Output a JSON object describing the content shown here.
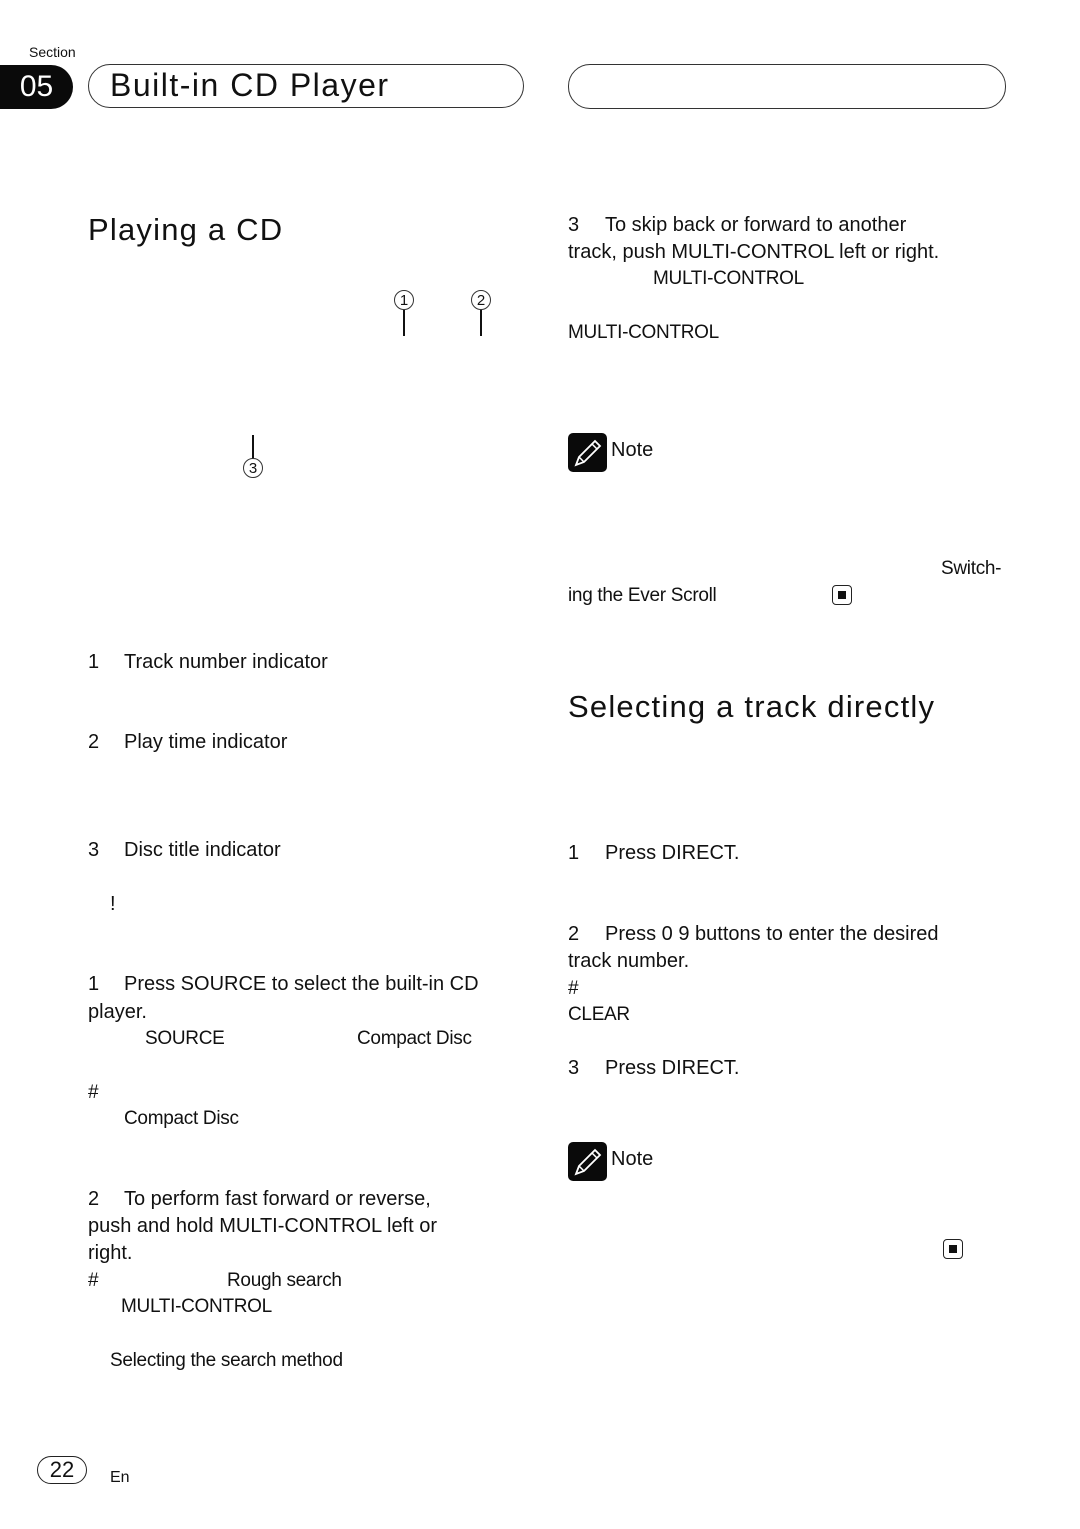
{
  "header": {
    "section_label": "Section",
    "section_number": "05",
    "chapter_title": "Built-in CD Player"
  },
  "left": {
    "heading": "Playing a CD",
    "callouts": [
      "1",
      "2",
      "3"
    ],
    "legend": [
      {
        "num": "1",
        "label": "Track number indicator"
      },
      {
        "num": "2",
        "label": "Play time indicator"
      },
      {
        "num": "3",
        "label": "Disc title indicator"
      }
    ],
    "warning_mark": "!",
    "step1": {
      "num": "1",
      "line1": "Press SOURCE to select the built-in CD",
      "line2": "player.",
      "frag_source": "SOURCE",
      "frag_compact": "Compact Disc",
      "hash": "#",
      "frag_compact2": "Compact Disc"
    },
    "step2": {
      "num": "2",
      "line1": "To perform fast forward or reverse,",
      "line2": "push and hold MULTI-CONTROL left or",
      "line3": "right.",
      "hash": "#",
      "frag_rough": "Rough search",
      "frag_multi": "MULTI-CONTROL",
      "frag_link": "Selecting the search method"
    }
  },
  "right": {
    "step3": {
      "num": "3",
      "line1": "To skip back or forward to another",
      "line2": "track, push MULTI-CONTROL left or right.",
      "frag_multi1": "MULTI-CONTROL",
      "frag_multi2": "MULTI-CONTROL"
    },
    "note1": {
      "label": "Note",
      "frag_switch": "Switch-",
      "frag_ever": "ing the Ever Scroll"
    },
    "heading2": "Selecting a track directly",
    "direct_steps": {
      "s1_num": "1",
      "s1_text": "Press DIRECT.",
      "s2_num": "2",
      "s2_line1": "Press 0  9 buttons to enter the desired",
      "s2_line2": "track number.",
      "hash": "#",
      "frag_clear": "CLEAR",
      "s3_num": "3",
      "s3_text": "Press DIRECT."
    },
    "note2": {
      "label": "Note"
    }
  },
  "footer": {
    "page_number": "22",
    "language": "En"
  }
}
